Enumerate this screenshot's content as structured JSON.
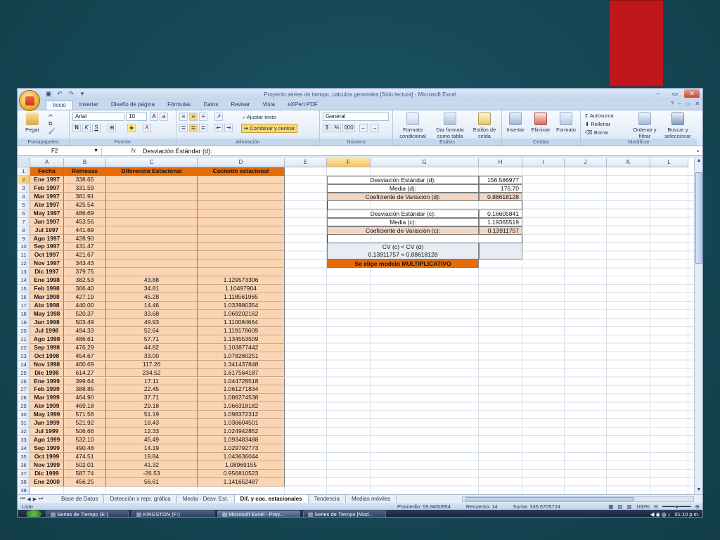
{
  "window": {
    "title": "Proyecto series de tiempo, calculos generales [Sólo lectura] - Microsoft Excel"
  },
  "ribbon_tabs": [
    "Inicio",
    "Insertar",
    "Diseño de página",
    "Fórmulas",
    "Datos",
    "Revisar",
    "Vista",
    "eXPert PDF"
  ],
  "ribbon": {
    "paste": "Pegar",
    "font_name": "Arial",
    "font_size": "10",
    "wrap_text": "Ajustar texto",
    "merge_center": "Combinar y centrar",
    "number_format": "General",
    "cond_format": "Formato condicional",
    "format_table": "Dar formato como tabla",
    "cell_styles": "Estilos de celda",
    "insert": "Insertar",
    "delete": "Eliminar",
    "format": "Formato",
    "autosum": "Autosuma",
    "fill": "Rellenar",
    "clear": "Borrar",
    "sort": "Ordenar y filtrar",
    "find": "Buscar y seleccionar",
    "groups": {
      "clipboard": "Portapapeles",
      "font": "Fuente",
      "alignment": "Alineación",
      "number": "Número",
      "styles": "Estilos",
      "cells": "Celdas",
      "editing": "Modificar"
    }
  },
  "formula_bar": {
    "cell_ref": "F2",
    "fx": "fx",
    "content": "Desviación Estándar (d):"
  },
  "columns": [
    "A",
    "B",
    "C",
    "D",
    "E",
    "F",
    "G",
    "H",
    "I",
    "J",
    "K",
    "L"
  ],
  "table": {
    "headers": [
      "Fecha",
      "Remesas",
      "Diferencia Estacional",
      "Cociente estacional"
    ],
    "rows": [
      [
        "Ene 1997",
        "338.65",
        "",
        ""
      ],
      [
        "Feb 1997",
        "331.59",
        "",
        ""
      ],
      [
        "Mar 1997",
        "381.91",
        "",
        ""
      ],
      [
        "Abr 1997",
        "425.54",
        "",
        ""
      ],
      [
        "May 1997",
        "486.69",
        "",
        ""
      ],
      [
        "Jun 1997",
        "453.56",
        "",
        ""
      ],
      [
        "Jul 1997",
        "441.69",
        "",
        ""
      ],
      [
        "Ago 1997",
        "428.90",
        "",
        ""
      ],
      [
        "Sep 1997",
        "431.47",
        "",
        ""
      ],
      [
        "Oct 1997",
        "421.67",
        "",
        ""
      ],
      [
        "Nov 1997",
        "343.43",
        "",
        ""
      ],
      [
        "Dic 1997",
        "379.75",
        "",
        ""
      ],
      [
        "Ene 1998",
        "382.53",
        "43.88",
        "1.129573306"
      ],
      [
        "Feb 1998",
        "366.40",
        "34.81",
        "1.10497904"
      ],
      [
        "Mar 1998",
        "427.19",
        "45.28",
        "1.118561965"
      ],
      [
        "Abr 1998",
        "440.00",
        "14.46",
        "1.033980354"
      ],
      [
        "May 1998",
        "520.37",
        "33.68",
        "1.069202162"
      ],
      [
        "Jun 1998",
        "503.49",
        "49.93",
        "1.110084664"
      ],
      [
        "Jul 1998",
        "494.33",
        "52.64",
        "1.119178609"
      ],
      [
        "Ago 1998",
        "486.61",
        "57.71",
        "1.134553509"
      ],
      [
        "Sep 1998",
        "476.29",
        "44.82",
        "1.103877442"
      ],
      [
        "Oct 1998",
        "454.67",
        "33.00",
        "1.078260251"
      ],
      [
        "Nov 1998",
        "460.69",
        "117.26",
        "1.341437848"
      ],
      [
        "Dic 1998",
        "614.27",
        "234.52",
        "1.617564187"
      ],
      [
        "Ene 1999",
        "399.64",
        "17.11",
        "1.044728518"
      ],
      [
        "Feb 1999",
        "388.85",
        "22.45",
        "1.061271834"
      ],
      [
        "Mar 1999",
        "464.90",
        "37.71",
        "1.088274538"
      ],
      [
        "Abr 1999",
        "469.18",
        "29.18",
        "1.066318182"
      ],
      [
        "May 1999",
        "571.56",
        "51.19",
        "1.098372312"
      ],
      [
        "Jun 1999",
        "521.92",
        "18.43",
        "1.036604501"
      ],
      [
        "Jul 1999",
        "506.66",
        "12.33",
        "1.024942852"
      ],
      [
        "Ago 1999",
        "532.10",
        "45.49",
        "1.093483488"
      ],
      [
        "Sep 1999",
        "490.48",
        "14.19",
        "1.029792773"
      ],
      [
        "Oct 1999",
        "474.51",
        "19.84",
        "1.043636044"
      ],
      [
        "Nov 1999",
        "502.01",
        "41.32",
        "1.08969155"
      ],
      [
        "Dic 1999",
        "587.74",
        "-26.53",
        "0.956810523"
      ],
      [
        "Ene 2000",
        "456.25",
        "56.61",
        "1.141652487"
      ]
    ]
  },
  "stats": {
    "sd_d_label": "Desviación Estándar (d):",
    "sd_d": "156.586977",
    "mean_d_label": "Media (d):",
    "mean_d": "176.70",
    "cv_d_label": "Coeficiente de Variación (d):",
    "cv_d": "0.88618128",
    "sd_c_label": "Desviación Estándar (c):",
    "sd_c": "0.16605841",
    "mean_c_label": "Media (c):",
    "mean_c": "1.19365519",
    "cv_c_label": "Coeficiente de Variación (c):",
    "cv_c": "0.13911757",
    "compare_label": "CV (c) < CV (d)",
    "compare_values": "0.13911757 < 0.88618128",
    "conclusion": "Se elige modelo MULTIPLICATIVO"
  },
  "sheet_tabs": [
    "Base de Datos",
    "Detección x repr. gráfica",
    "Media - Desv. Est.",
    "Dif. y coc. estacionales",
    "Tendencia",
    "Medias móviles"
  ],
  "status": {
    "ready": "Listo",
    "average": "Promedio: 55.9450954",
    "count": "Recuento: 14",
    "sum": "Suma: 335.6705724",
    "zoom": "100%"
  },
  "taskbar": {
    "items": [
      "Series de Tiempo (E:)",
      "KINGSTON (F:)",
      "Microsoft Excel - Proy...",
      "Series de Tiempo [Mod..."
    ],
    "clock": "01:10 p.m."
  },
  "colors": {
    "orange_fill": "#fbd4b4",
    "orange_header": "#e46c0a",
    "slide_bg": "#174a58",
    "red_accent": "#c0161c"
  }
}
